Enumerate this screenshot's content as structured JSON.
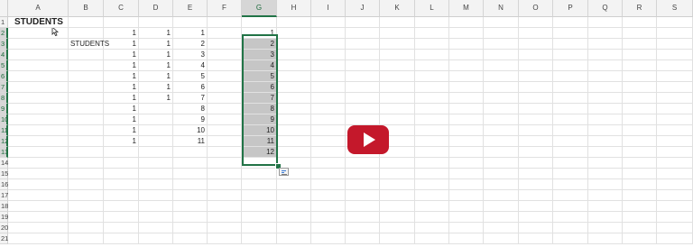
{
  "sheet": {
    "columns": [
      "A",
      "B",
      "C",
      "D",
      "E",
      "F",
      "G",
      "H",
      "I",
      "J",
      "K",
      "L",
      "M",
      "N",
      "O",
      "P",
      "Q",
      "R",
      "S"
    ],
    "selected_column": "G",
    "rows": [
      "1",
      "2",
      "3",
      "4",
      "5",
      "6",
      "7",
      "8",
      "9",
      "10",
      "11",
      "12",
      "13",
      "14",
      "15",
      "16",
      "17",
      "18",
      "19",
      "20",
      "21"
    ],
    "selected_rows": [
      "2",
      "3",
      "4",
      "5",
      "6",
      "7",
      "8",
      "9",
      "10",
      "11",
      "12",
      "13"
    ]
  },
  "cells": {
    "a1": "STUDENTS",
    "b3": "STUDENTS",
    "c": [
      "1",
      "1",
      "1",
      "1",
      "1",
      "1",
      "1",
      "1",
      "1",
      "1",
      "1"
    ],
    "d": [
      "1",
      "1",
      "1",
      "1",
      "1",
      "1",
      "1"
    ],
    "e": [
      "1",
      "2",
      "3",
      "4",
      "5",
      "6",
      "7",
      "8",
      "9",
      "10",
      "11"
    ],
    "g": [
      "1",
      "2",
      "3",
      "4",
      "5",
      "6",
      "7",
      "8",
      "9",
      "10",
      "11",
      "12"
    ]
  },
  "icons": {
    "quick_analysis": "quick-analysis-icon",
    "play": "play-icon",
    "cursor": "cursor-icon"
  },
  "colors": {
    "selection_border": "#217346",
    "selection_fill": "#c6c6c6",
    "play_button": "#c4182b"
  }
}
